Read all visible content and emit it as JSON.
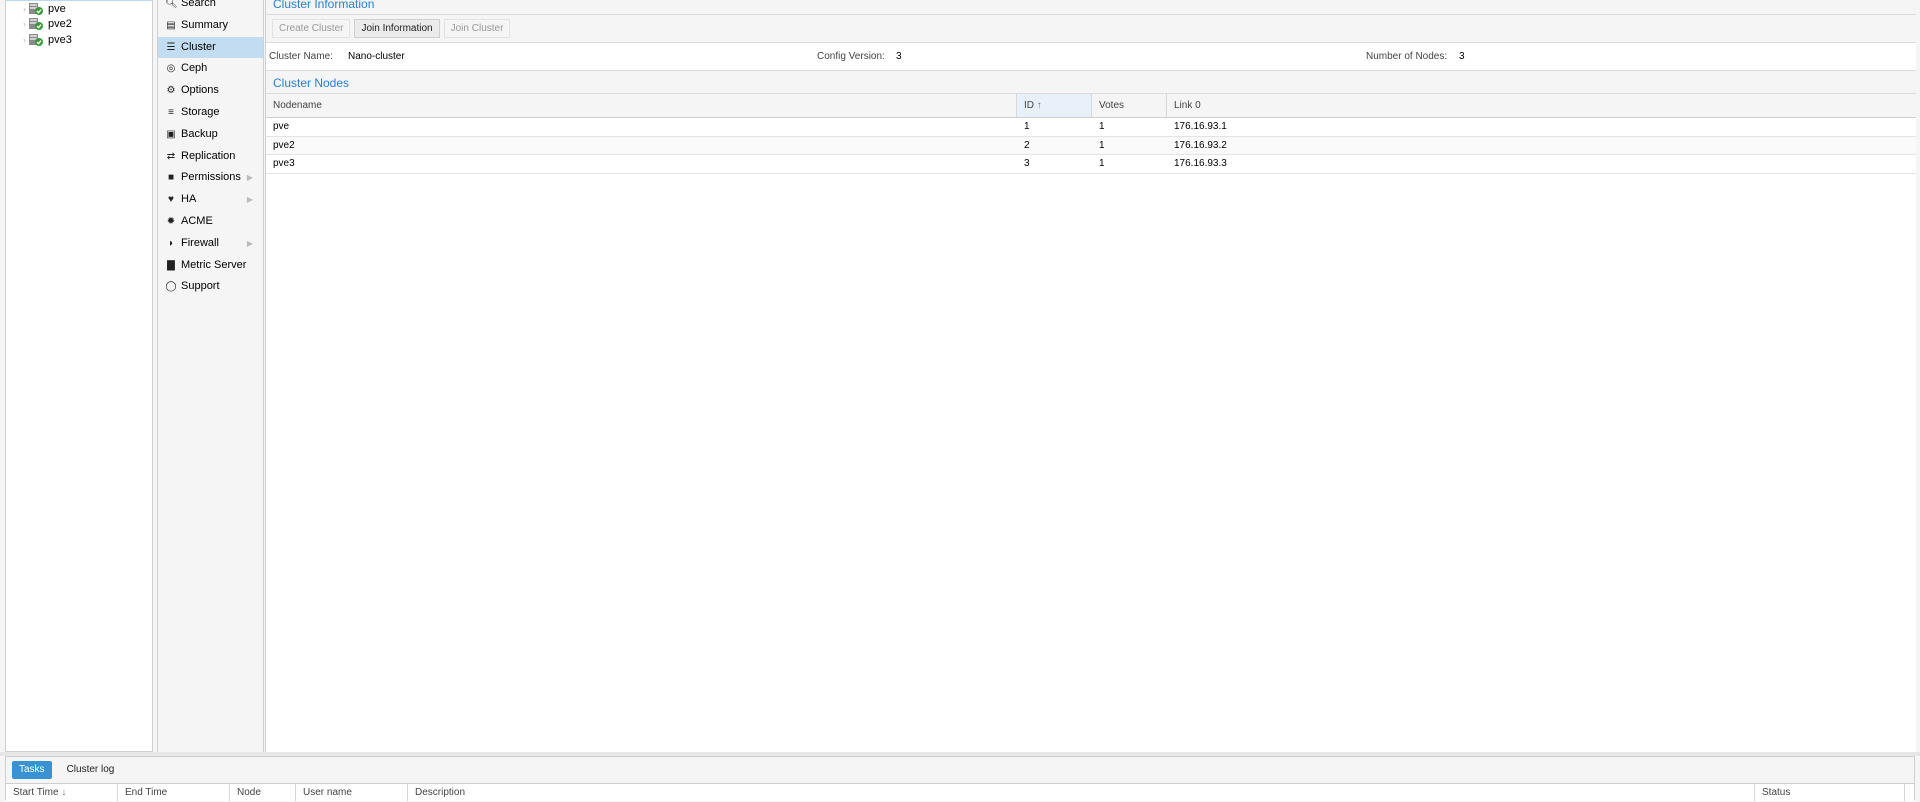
{
  "tree": {
    "nodes": [
      {
        "label": "pve",
        "icon": "node-online-icon"
      },
      {
        "label": "pve2",
        "icon": "node-online-icon"
      },
      {
        "label": "pve3",
        "icon": "node-online-icon"
      }
    ]
  },
  "menu": {
    "items": [
      {
        "label": "Search",
        "icon": "search-icon"
      },
      {
        "label": "Summary",
        "icon": "book-icon"
      },
      {
        "label": "Cluster",
        "icon": "list-icon",
        "active": true
      },
      {
        "label": "Ceph",
        "icon": "ceph-icon"
      },
      {
        "label": "Options",
        "icon": "gear-icon"
      },
      {
        "label": "Storage",
        "icon": "database-icon"
      },
      {
        "label": "Backup",
        "icon": "floppy-icon"
      },
      {
        "label": "Replication",
        "icon": "retweet-icon"
      },
      {
        "label": "Permissions",
        "icon": "unlock-icon",
        "submenu": true
      },
      {
        "label": "HA",
        "icon": "heartbeat-icon",
        "submenu": true
      },
      {
        "label": "ACME",
        "icon": "certificate-icon"
      },
      {
        "label": "Firewall",
        "icon": "shield-icon",
        "submenu": true
      },
      {
        "label": "Metric Server",
        "icon": "bar-chart-icon"
      },
      {
        "label": "Support",
        "icon": "comments-icon"
      }
    ]
  },
  "main": {
    "title": "Cluster Information",
    "toolbar": {
      "create_cluster": "Create Cluster",
      "join_information": "Join Information",
      "join_cluster": "Join Cluster"
    },
    "info": {
      "cluster_name_label": "Cluster Name:",
      "cluster_name_value": "Nano-cluster",
      "config_version_label": "Config Version:",
      "config_version_value": "3",
      "nodes_label": "Number of Nodes:",
      "nodes_value": "3"
    },
    "nodes_title": "Cluster Nodes",
    "columns": {
      "nodename": "Nodename",
      "id": "ID",
      "votes": "Votes",
      "link0": "Link 0"
    },
    "rows": [
      {
        "nodename": "pve",
        "id": "1",
        "votes": "1",
        "link0": "176.16.93.1"
      },
      {
        "nodename": "pve2",
        "id": "2",
        "votes": "1",
        "link0": "176.16.93.2"
      },
      {
        "nodename": "pve3",
        "id": "3",
        "votes": "1",
        "link0": "176.16.93.3"
      }
    ]
  },
  "bottom": {
    "tabs": {
      "tasks": "Tasks",
      "cluster_log": "Cluster log"
    },
    "columns": {
      "start_time": "Start Time",
      "end_time": "End Time",
      "node": "Node",
      "user_name": "User name",
      "description": "Description",
      "status": "Status"
    }
  },
  "colors": {
    "accent": "#2a7fd2",
    "active_menu": "#c2ddf2",
    "active_tab": "#3892d4",
    "node_online": "#3a9a3a"
  }
}
